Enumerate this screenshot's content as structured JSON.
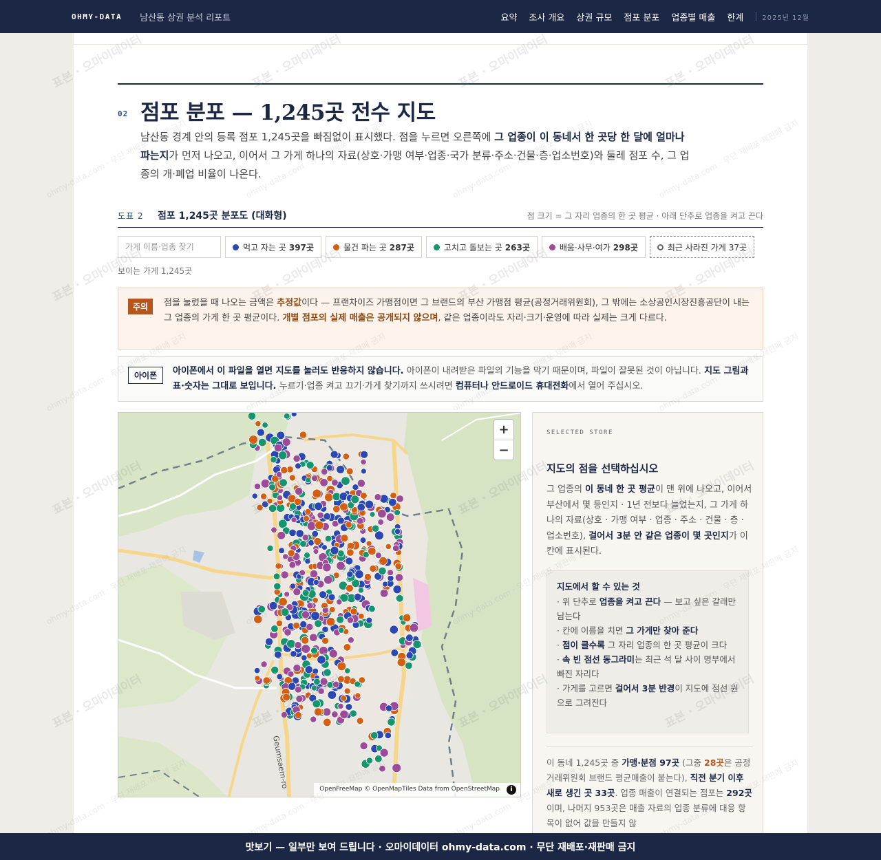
{
  "topbar": {
    "brand": "OHMY-DATA",
    "report_title": "남산동 상권 분석 리포트",
    "nav": [
      "요약",
      "조사 개요",
      "상권 규모",
      "점포 분포",
      "업종별 매출",
      "한계"
    ],
    "date": "2025년 12월"
  },
  "section": {
    "number": "02",
    "title": "점포 분포 — 1,245곳 전수 지도",
    "lead_1": "남산동 경계 안의 등록 점포 1,245곳을 빠짐없이 표시했다. 점을 누르면 오른쪽에 ",
    "lead_b": "그 업종이 이 동네서 한 곳당 한 달에 얼마나 파는지",
    "lead_2": "가 먼저 나오고, 이어서 그 가게 하나의 자료(상호·가맹 여부·업종·국가 분류·주소·건물·층·업소번호)와 둘레 점포 수, 그 업종의 개·폐업 비율이 나온다."
  },
  "figure": {
    "label": "도표 2",
    "title": "점포 1,245곳 분포도 (대화형)",
    "note": "점 크기 = 그 자리 업종의 한 곳 평균 · 아래 단추로 업종을 켜고 끈다"
  },
  "filters": {
    "search_placeholder": "가게 이름·업종 찾기",
    "chips": [
      {
        "label": "먹고 자는 곳",
        "count": "397곳",
        "color": "#2a47b2"
      },
      {
        "label": "물건 파는 곳",
        "count": "287곳",
        "color": "#d35f12"
      },
      {
        "label": "고치고 돌보는 곳",
        "count": "263곳",
        "color": "#16946d"
      },
      {
        "label": "배움·사무·여가",
        "count": "298곳",
        "color": "#9b4b97"
      }
    ],
    "gone_chip": {
      "label": "최근 사라진 가게",
      "count": "37곳"
    },
    "visible_count": "보이는 가게 1,245곳"
  },
  "caution": {
    "tag": "주의",
    "t1": "점을 눌렀을 때 나오는 금액은 ",
    "b1": "추정값",
    "t2": "이다 — 프랜차이즈 가맹점이면 그 브랜드의 부산 가맹점 평균(공정거래위원회), 그 밖에는 소상공인시장진흥공단이 내는 그 업종의 가게 한 곳 평균이다. ",
    "b2": "개별 점포의 실제 매출은 공개되지 않으며",
    "t3": ", 같은 업종이라도 자리·크기·운영에 따라 실제는 크게 다르다."
  },
  "iphone": {
    "tag": "아이폰",
    "b1": "아이폰에서 이 파일을 열면 지도를 눌러도 반응하지 않습니다.",
    "t1": " 아이폰이 내려받은 파일의 기능을 막기 때문이며, 파일이 잘못된 것이 아닙니다. ",
    "b2": "지도 그림과 표·숫자는 그대로 보입니다.",
    "t2": " 누르기·업종 켜고 끄기·가게 찾기까지 쓰시려면 ",
    "b3": "컴퓨터나 안드로이드 휴대전화",
    "t3": "에서 열어 주십시오."
  },
  "map": {
    "zoom_in": "+",
    "zoom_out": "−",
    "attribution": "OpenFreeMap © OpenMapTiles Data from OpenStreetMap",
    "info": "i",
    "road_label": "Geumsaem-ro"
  },
  "panel": {
    "kicker": "SELECTED STORE",
    "title": "지도의 점을 선택하십시오",
    "d1": "그 업종의 ",
    "db1": "이 동네 한 곳 평균",
    "d2": "이 맨 위에 나오고, 이어서 부산에서 몇 등인지 · 1년 전보다 늘었는지, 그 가게 하나의 자료(상호 · 가맹 여부 · 업종 · 주소 · 건물 · 층 · 업소번호), ",
    "db2": "걸어서 3분 안 같은 업종이 몇 곳인지",
    "d3": "가 이 칸에 표시된다.",
    "howto_title": "지도에서 할 수 있는 것",
    "h1a": "· 위 단추로 ",
    "h1b": "업종을 켜고 끈다",
    "h1c": " — 보고 싶은 갈래만 남는다",
    "h2a": "· 칸에 이름을 치면 ",
    "h2b": "그 가게만 찾아 준다",
    "h3a": "· ",
    "h3b": "점이 클수록",
    "h3c": " 그 자리 업종의 한 곳 평균이 크다",
    "h4a": "· ",
    "h4b": "속 빈 점선 동그라미",
    "h4c": "는 최근 석 달 사이 명부에서 빠진 자리다",
    "h5a": "· 가게를 고르면 ",
    "h5b": "걸어서 3분 반경",
    "h5c": "이 지도에 점선 원으로 그려진다",
    "s1": "이 동네 1,245곳 중 ",
    "sb1": "가맹·분점 97곳",
    "s2": " (그중 ",
    "sb2": "28곳",
    "s3": "은 공정거래위원회 브랜드 평균매출이 붙는다), ",
    "sb3": "직전 분기 이후 새로 생긴 곳 33곳",
    "s4": ". 업종 매출이 연결되는 점포는 ",
    "sb4": "292곳",
    "s5": "이며, 나머지 953곳은 매출 자료의 업종 분류에 대응 항목이 없어 값을 만들지 않"
  },
  "banner": "맛보기 — 일부만 보여 드립니다 · 오마이데이터 ohmy-data.com · 무단 재배포·재판매 금지",
  "watermark": {
    "w1": "표본 · 오마이데이터",
    "w2": "ohmy-data.com · 무단 재배포·재판매 금지"
  },
  "colors": {
    "navy": "#1b2745",
    "food": "#2a47b2",
    "retail": "#d35f12",
    "service": "#16946d",
    "edu": "#9b4b97"
  }
}
